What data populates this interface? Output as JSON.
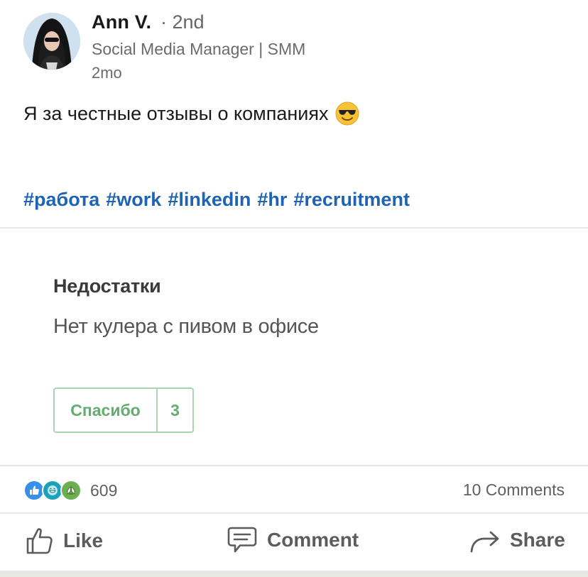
{
  "author": {
    "name": "Ann V.",
    "degree": "· 2nd",
    "headline": "Social Media Manager | SMM",
    "time": "2mo"
  },
  "post": {
    "text": "Я за честные отзывы о компаниях",
    "emoji": "smiling-face-with-sunglasses-icon",
    "hashtags": [
      "#работа",
      "#work",
      "#linkedin",
      "#hr",
      "#recruitment"
    ]
  },
  "media": {
    "review_title": "Недостатки",
    "review_body": "Нет кулера с пивом в офисе",
    "thanks_label": "Спасибо",
    "thanks_count": "3"
  },
  "stats": {
    "reaction_icons": [
      "like-icon",
      "funny-icon",
      "celebrate-icon"
    ],
    "reactions_count": "609",
    "comments": "10 Comments"
  },
  "actions": {
    "like": "Like",
    "comment": "Comment",
    "share": "Share"
  },
  "colors": {
    "hashtag": "#1f63b4",
    "thanks_green": "#62ad6f",
    "like_blue": "#378fe9",
    "celebrate_green": "#44712e"
  }
}
